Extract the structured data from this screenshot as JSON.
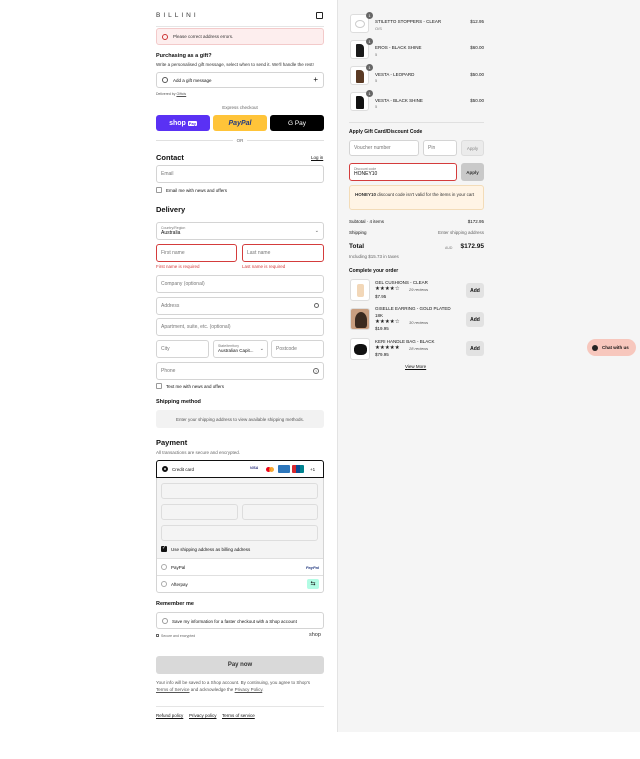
{
  "brand": "BILLINI",
  "error_banner": "Please correct address errors.",
  "gift": {
    "title": "Purchasing as a gift?",
    "subtitle": "Write a personalised gift message, select when to send it. We'll handle the rest!",
    "add_label": "Add a gift message",
    "delivered_by": "Delivered by",
    "delivered_by_link": "Giftcls"
  },
  "express": {
    "label": "Express checkout",
    "shop_pay": "shop",
    "shop_pay_tag": "Pay",
    "paypal": "PayPal",
    "gpay": "G Pay",
    "or": "OR"
  },
  "contact": {
    "title": "Contact",
    "login": "Log in",
    "email_placeholder": "Email",
    "email_news": "Email me with news and offers"
  },
  "delivery": {
    "title": "Delivery",
    "country_label": "Country/Region",
    "country_value": "Australia",
    "first_name": "First name",
    "last_name": "Last name",
    "first_error": "First name is required",
    "last_error": "Last name is required",
    "company": "Company (optional)",
    "address": "Address",
    "apartment": "Apartment, suite, etc. (optional)",
    "city": "City",
    "state_label": "State/territory",
    "state_value": "Australian Capit...",
    "postcode": "Postcode",
    "phone": "Phone",
    "text_news": "Text me with news and offers"
  },
  "shipping": {
    "title": "Shipping method",
    "note": "Enter your shipping address to view available shipping methods."
  },
  "payment": {
    "title": "Payment",
    "subtitle": "All transactions are secure and encrypted.",
    "credit_card": "Credit card",
    "more_cards": "+1",
    "card_icons": [
      "visa-icon",
      "mastercard-icon",
      "amex-icon",
      "unionpay-icon"
    ],
    "billing_same": "Use shipping address as billing address",
    "paypal": "PayPal",
    "paypal_logo": "PayPal",
    "afterpay": "Afterpay"
  },
  "remember": {
    "title": "Remember me",
    "option": "Save my information for a faster checkout with a Shop account",
    "secure": "Secure and encrypted",
    "shop": "shop"
  },
  "pay_now": "Pay now",
  "terms": {
    "text1": "Your info will be saved to a Shop account. By continuing, you agree to Shop's",
    "tos": "Terms of Service",
    "and": "and acknowledge the",
    "privacy": "Privacy Policy",
    "period": "."
  },
  "footer_links": [
    "Refund policy",
    "Privacy policy",
    "Terms of service"
  ],
  "cart": {
    "items": [
      {
        "qty": "1",
        "name": "STILETTO STOPPERS - CLEAR",
        "variant": "O/S",
        "price": "$12.95"
      },
      {
        "qty": "1",
        "name": "EROS - BLACK SHINE",
        "variant": "5",
        "price": "$60.00"
      },
      {
        "qty": "1",
        "name": "VESTA - LEOPARD",
        "variant": "5",
        "price": "$50.00"
      },
      {
        "qty": "1",
        "name": "VESTA - BLACK SHINE",
        "variant": "5",
        "price": "$50.00"
      }
    ],
    "discount_title": "Apply Gift Card/Discount Code",
    "voucher_placeholder": "Voucher number",
    "pin_placeholder": "Pin",
    "apply": "Apply",
    "discount_label": "Discount code",
    "discount_value": "HONEY10",
    "discount_warning_code": "HONEY10",
    "discount_warning": " discount code isn't valid for the items in your cart",
    "subtotal_label": "Subtotal · 4 items",
    "subtotal": "$172.95",
    "shipping_label": "Shipping",
    "shipping_value": "Enter shipping address",
    "total_label": "Total",
    "currency": "AUD",
    "total": "$172.95",
    "taxes": "Including $15.73 in taxes"
  },
  "upsell": {
    "title": "Complete your order",
    "items": [
      {
        "name": "GEL CUSHIONS - CLEAR",
        "sub": "",
        "stars": "★★★★☆",
        "reviews": "29 reviews",
        "price": "$7.95",
        "add": "Add"
      },
      {
        "name": "GISELLE EARRING - GOLD PLATED",
        "sub": "18K",
        "stars": "★★★★☆",
        "reviews": "30 reviews",
        "price": "$19.95",
        "add": "Add"
      },
      {
        "name": "KERI HANDLE BAG - BLACK",
        "sub": "",
        "stars": "★★★★★",
        "reviews": "28 reviews",
        "price": "$79.95",
        "add": "Add"
      }
    ],
    "view_more": "View More"
  },
  "chat": "Chat with us"
}
